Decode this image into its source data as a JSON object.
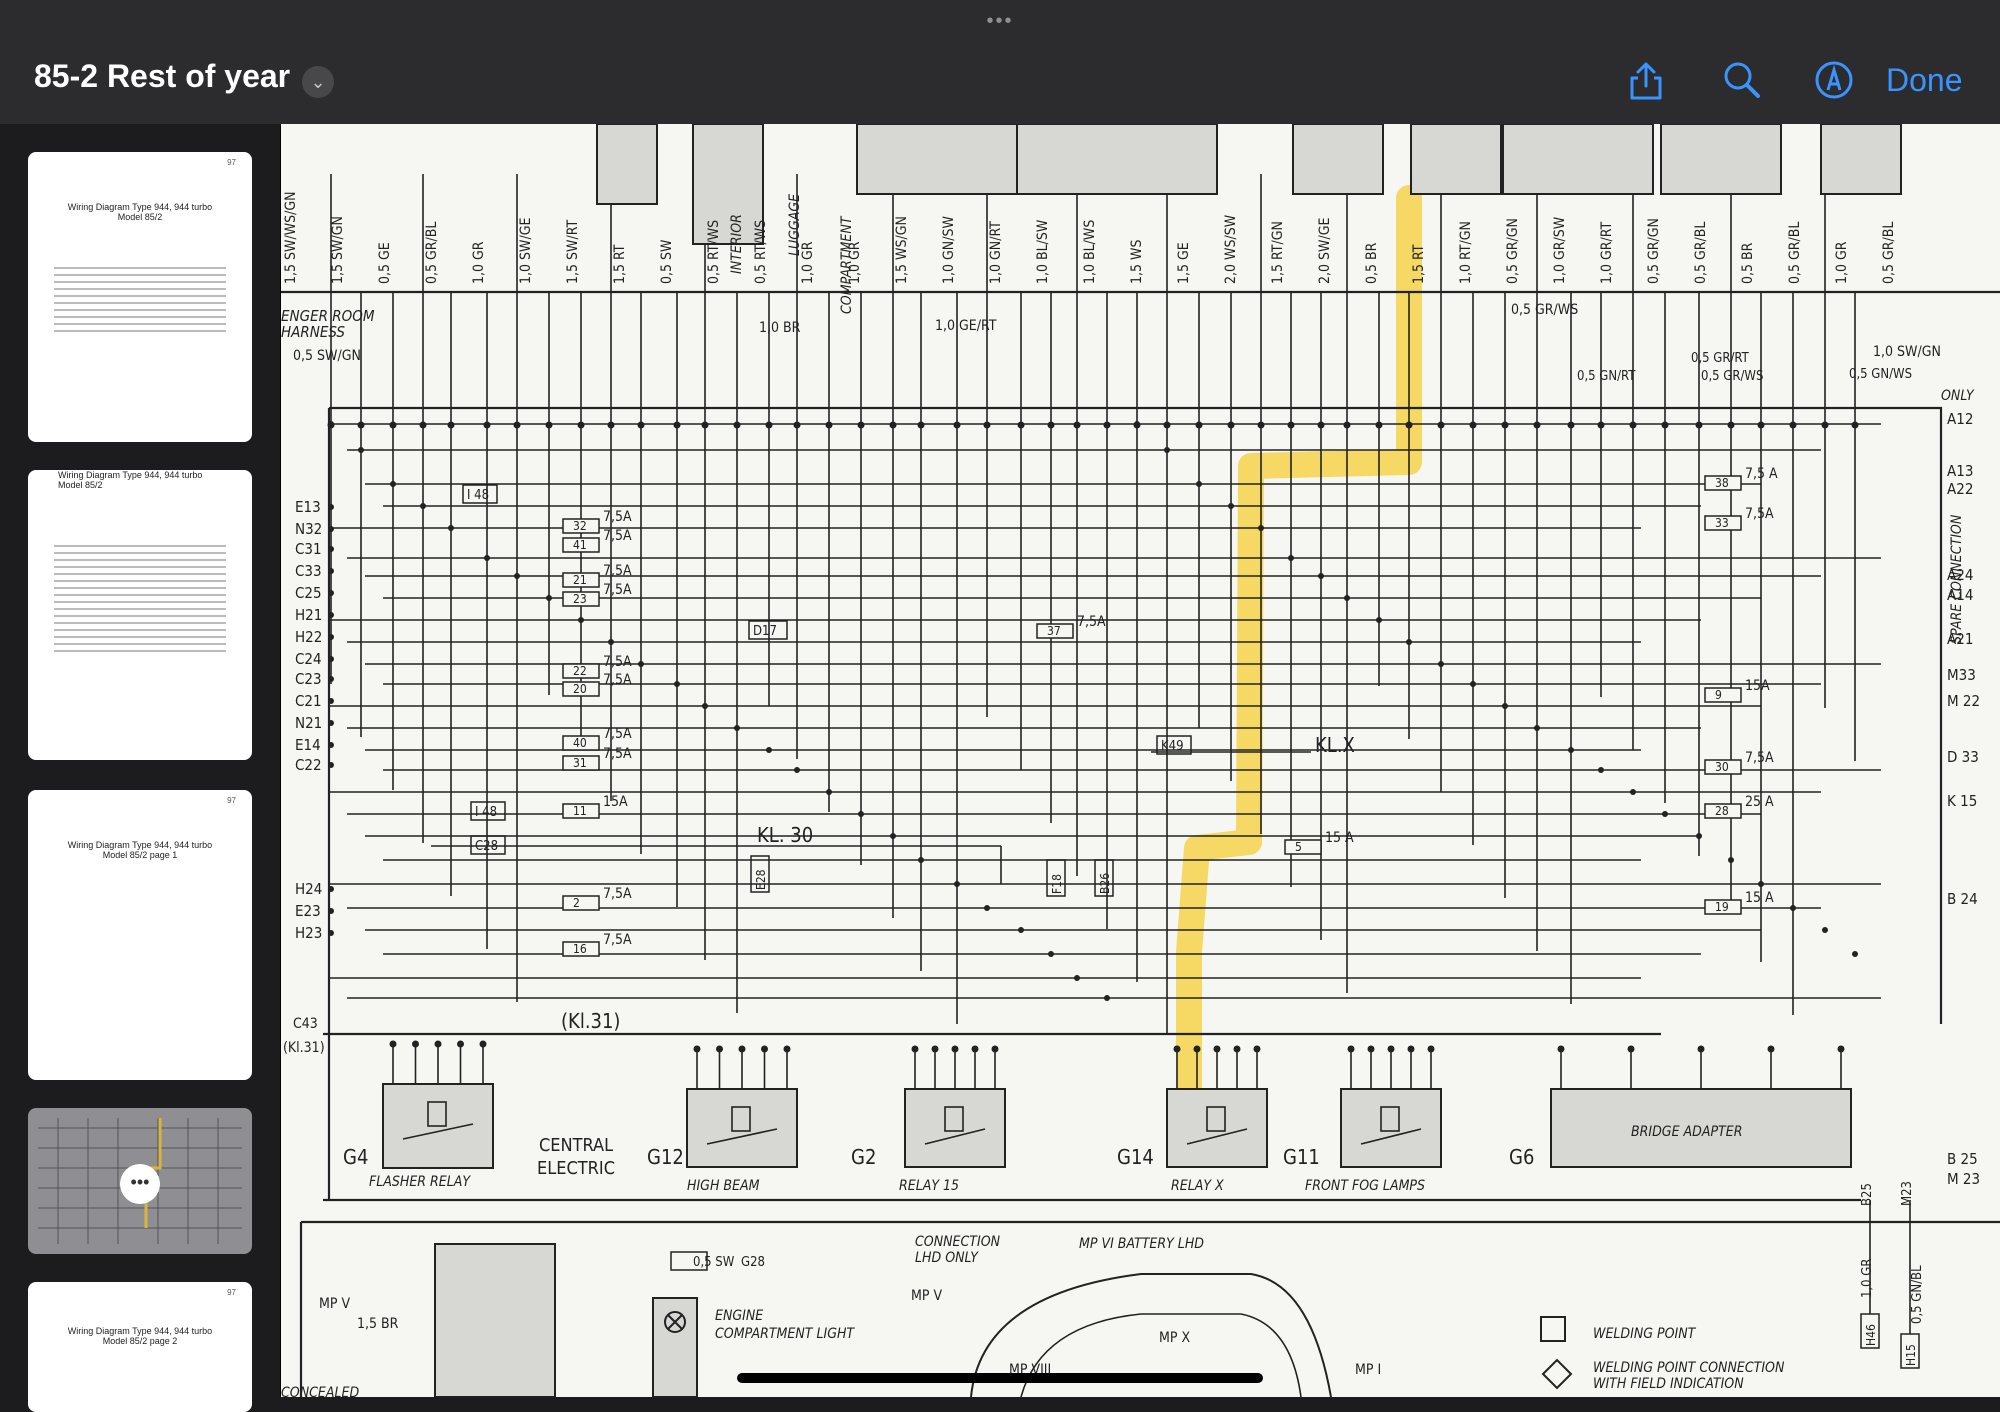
{
  "toolbar": {
    "title": "85-2 Rest of year",
    "done_label": "Done",
    "icons": [
      "share-icon",
      "search-icon",
      "markup-icon",
      "chevron-down-icon"
    ],
    "accent_color": "#3a94ff"
  },
  "sidebar": {
    "thumbnails": [
      {
        "page": "97",
        "title": "Wiring Diagram Type 944, 944 turbo\nModel 85/2"
      },
      {
        "page": "",
        "title": "Wiring Diagram Type 944, 944 turbo\nModel 85/2"
      },
      {
        "page": "97",
        "title": "Wiring Diagram Type 944, 944 turbo\nModel 85/2 page 1"
      },
      {
        "page": "",
        "title": ""
      },
      {
        "page": "97",
        "title": "Wiring Diagram Type 944, 944 turbo\nModel 85/2 page 2"
      }
    ]
  },
  "diagram": {
    "highlight_color": "#f5d44a",
    "top_wires": [
      "1,5 SW/WS/GN",
      "1,5 SW/GN",
      "0,5 GE",
      "0,5 GR/BL",
      "1,0 GR",
      "1,0 SW/GE",
      "1,5 SW/RT",
      "1,5 RT",
      "0,5 SW",
      "0,5 RT/WS",
      "0,5 RT/WS",
      "1,0 GR",
      "1,0 GR",
      "1,5 WS/GN",
      "1,0 GN/SW",
      "1,0 GN/RT",
      "1,0 BL/SW",
      "1,0 BL/WS",
      "1,5 WS",
      "1,5 GE",
      "2,0 WS/SW",
      "1,5 RT/GN",
      "2,0 SW/GE",
      "0,5 BR",
      "1,5 RT",
      "1,0 RT/GN",
      "0,5 GR/GN",
      "1,0 GR/SW",
      "1,0 GR/RT",
      "0,5 GR/GN",
      "0,5 GR/BL",
      "0,5 BR",
      "0,5 GR/BL",
      "1,0 GR",
      "0,5 GR/BL"
    ],
    "labels": {
      "engine_room": "ENGER ROOM",
      "harness": "HARNESS",
      "luggage": "LUGGAGE",
      "compartment": "COMPARTMENT",
      "interior": "INTERIOR",
      "spare_connection": "SPARE CONNECTION",
      "only": "ONLY",
      "kl30": "KL. 30",
      "kl31": "(Kl.31)",
      "klx": "KL.X",
      "central_electric_1": "CENTRAL",
      "central_electric_2": "ELECTRIC",
      "sw_gn": "0,5 SW/GN",
      "br_1": "1,0 BR",
      "ge_rt": "1,0 GE/RT",
      "gr_ws": "0,5 GR/WS",
      "gn_rt": "0,5 GN/RT",
      "gr_rt": "0,5 GR/RT",
      "gr_ws2": "0,5 GR/WS",
      "sw_gn2": "1,0 SW/GN",
      "gn_ws": "0,5 GN/WS",
      "c43": "C43",
      "k49": "K49",
      "d17": "D17",
      "i48": "I 48",
      "i48b": "I 48",
      "c28": "C28",
      "e28": "E28",
      "f18": "F18",
      "b26": "B26"
    },
    "left_connectors": [
      "E13",
      "N32",
      "C31",
      "C33",
      "C25",
      "H21",
      "H22",
      "C24",
      "C23",
      "C21",
      "N21",
      "E14",
      "C22",
      "H24",
      "E23",
      "H23"
    ],
    "right_connectors": [
      "A12",
      "A13",
      "A22",
      "A24",
      "A14",
      "A21",
      "M33",
      "M 22",
      "D 33",
      "K 15",
      "B 24",
      "B 25",
      "M 23"
    ],
    "fuses": [
      {
        "num": "32",
        "amp": "7,5A"
      },
      {
        "num": "41",
        "amp": "7,5A"
      },
      {
        "num": "21",
        "amp": "7,5A"
      },
      {
        "num": "23",
        "amp": "7,5A"
      },
      {
        "num": "22",
        "amp": "7,5A"
      },
      {
        "num": "20",
        "amp": "7,5A"
      },
      {
        "num": "40",
        "amp": "7,5A"
      },
      {
        "num": "31",
        "amp": "7,5A"
      },
      {
        "num": "11",
        "amp": "15A"
      },
      {
        "num": "2",
        "amp": "7,5A"
      },
      {
        "num": "16",
        "amp": "7,5A"
      },
      {
        "num": "37",
        "amp": "7,5A"
      },
      {
        "num": "5",
        "amp": "15 A"
      },
      {
        "num": "38",
        "amp": "7,5 A"
      },
      {
        "num": "33",
        "amp": "7,5A"
      },
      {
        "num": "9",
        "amp": "15A"
      },
      {
        "num": "30",
        "amp": "7,5A"
      },
      {
        "num": "28",
        "amp": "25 A"
      },
      {
        "num": "19",
        "amp": "15 A"
      }
    ],
    "relays": [
      {
        "id": "G4",
        "name": "FLASHER RELAY"
      },
      {
        "id": "G12",
        "name": "HIGH BEAM"
      },
      {
        "id": "G2",
        "name": "RELAY 15"
      },
      {
        "id": "G14",
        "name": "RELAY X"
      },
      {
        "id": "G11",
        "name": "FRONT FOG LAMPS"
      },
      {
        "id": "G6",
        "name": "BRIDGE ADAPTER"
      }
    ],
    "bottom": {
      "mp5": "MP V",
      "br15": "1,5 BR",
      "sw": "0,5 SW",
      "g28": "G28",
      "engine_light_1": "ENGINE",
      "engine_light_2": "COMPARTMENT LIGHT",
      "connection_1": "CONNECTION",
      "connection_2": "LHD ONLY",
      "battery": "MP VI  BATTERY LHD",
      "mp5b": "MP V",
      "mp10": "MP X",
      "mp8": "MP VIII",
      "mp1": "MP I",
      "welding_point": "WELDING POINT",
      "welding_field_1": "WELDING POINT CONNECTION",
      "welding_field_2": "WITH FIELD INDICATION",
      "concealed": "CONCEALED",
      "b25": "B25",
      "m23": "M23",
      "gr": "1,0 GR",
      "gn_bl": "0,5 GN/BL",
      "h46": "H46",
      "h15": "H15"
    }
  }
}
